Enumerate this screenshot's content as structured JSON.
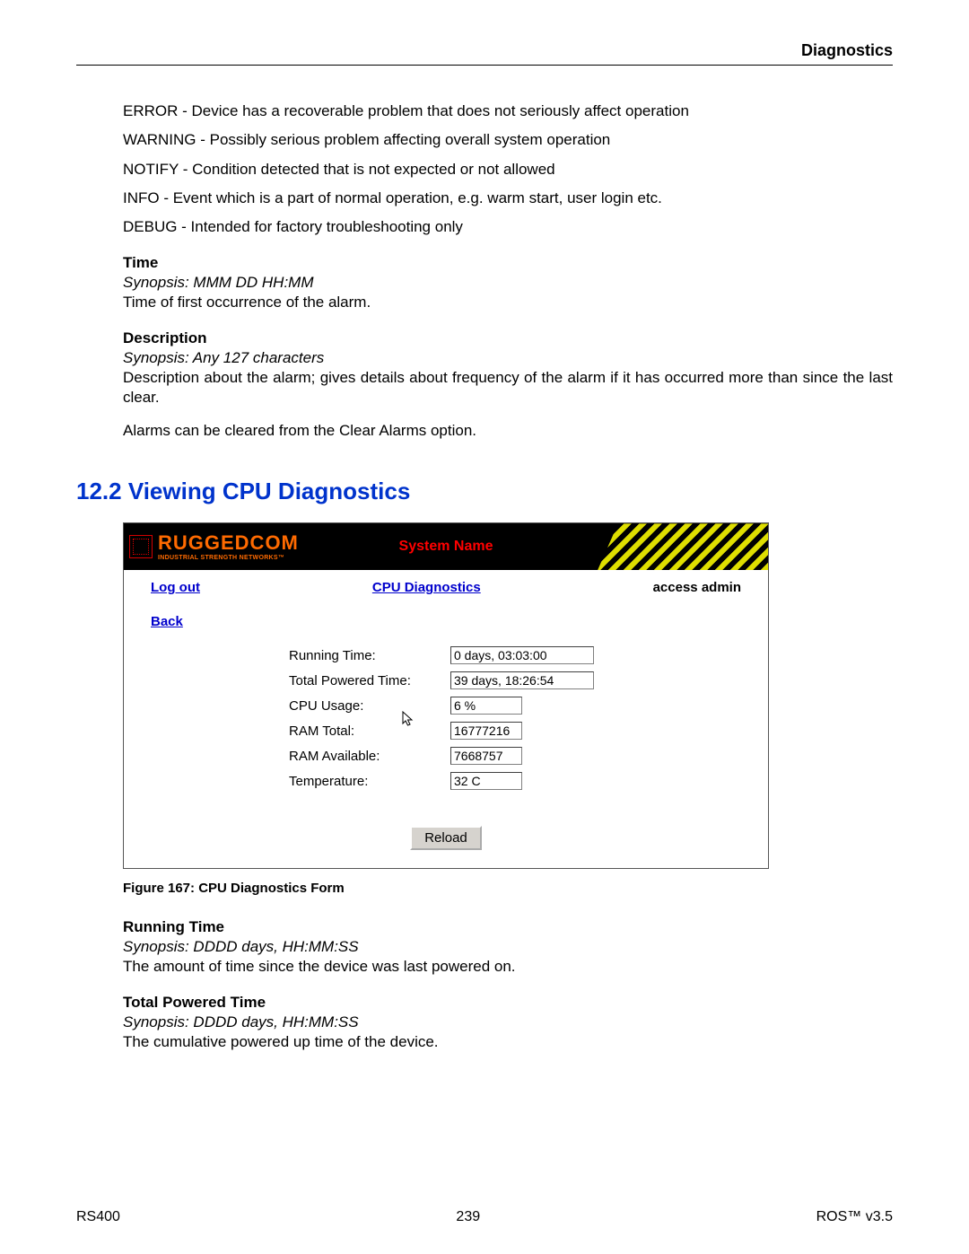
{
  "header": {
    "section": "Diagnostics"
  },
  "severity_lines": [
    "ERROR - Device has a recoverable problem that does not seriously affect operation",
    "WARNING - Possibly serious problem affecting overall system operation",
    "NOTIFY - Condition detected that is not expected or not allowed",
    "INFO - Event which is a part of normal operation, e.g. warm start, user login etc.",
    "DEBUG - Intended for factory troubleshooting only"
  ],
  "time_block": {
    "title": "Time",
    "synopsis": "Synopsis: MMM DD HH:MM",
    "desc": "Time of first occurrence of the alarm."
  },
  "description_block": {
    "title": "Description",
    "synopsis": "Synopsis: Any 127 characters",
    "desc": "Description about the alarm; gives details about frequency of the alarm if it has occurred more than since the last clear."
  },
  "clear_note": "Alarms can be cleared from the Clear Alarms option.",
  "section_heading": "12.2  Viewing CPU Diagnostics",
  "ui": {
    "logo_main": "RUGGEDCOM",
    "logo_tag": "INDUSTRIAL STRENGTH NETWORKS™",
    "system_name": "System Name",
    "logout": "Log out",
    "page_title": "CPU Diagnostics",
    "access": "access admin",
    "back": "Back",
    "fields": [
      {
        "label": "Running Time:",
        "value": "0 days, 03:03:00",
        "w": "full"
      },
      {
        "label": "Total Powered Time:",
        "value": "39 days, 18:26:54",
        "w": "full"
      },
      {
        "label": "CPU Usage:",
        "value": "6 %",
        "w": "half"
      },
      {
        "label": "RAM Total:",
        "value": "16777216",
        "w": "half"
      },
      {
        "label": "RAM Available:",
        "value": "7668757",
        "w": "half"
      },
      {
        "label": "Temperature:",
        "value": "32 C",
        "w": "half"
      }
    ],
    "reload": "Reload"
  },
  "figure_caption": "Figure 167: CPU Diagnostics Form",
  "running_time_block": {
    "title": "Running Time",
    "synopsis": "Synopsis: DDDD days, HH:MM:SS",
    "desc": "The amount of time since the device was last powered on."
  },
  "total_powered_block": {
    "title": "Total Powered Time",
    "synopsis": "Synopsis: DDDD days, HH:MM:SS",
    "desc": "The cumulative powered up time of the device."
  },
  "footer": {
    "left": "RS400",
    "center": "239",
    "right": "ROS™  v3.5"
  }
}
